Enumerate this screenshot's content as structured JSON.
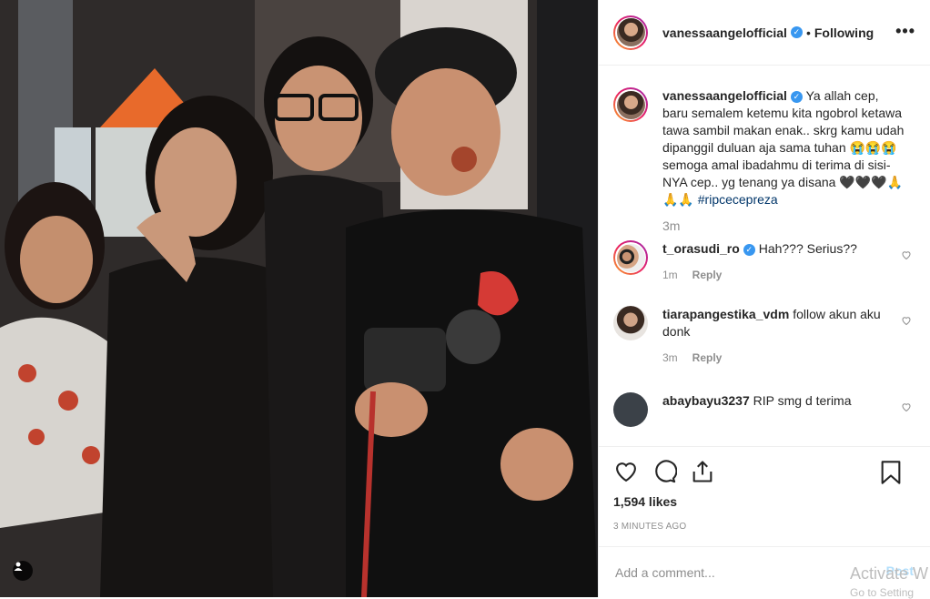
{
  "post": {
    "username": "vanessaangelofficial",
    "dot": "•",
    "follow_status": "Following",
    "more_label": "•••",
    "caption": "Ya allah cep, baru semalem ketemu kita ngobrol ketawa tawa sambil makan enak.. skrg kamu udah dipanggil duluan aja sama tuhan 😭😭😭 semoga amal ibadahmu di terima di sisi-NYA cep.. yg tenang ya disana 🖤🖤🖤🙏🙏🙏",
    "hashtag": "#ripcecepreza",
    "caption_time": "3m",
    "likes": "1,594 likes",
    "posted_ago": "3 MINUTES AGO",
    "add_comment_placeholder": "Add a comment...",
    "post_label": "Post"
  },
  "comments": [
    {
      "username": "t_orasudi_ro",
      "verified": true,
      "text": "Hah??? Serius??",
      "time": "1m",
      "reply": "Reply"
    },
    {
      "username": "tiarapangestika_vdm",
      "verified": false,
      "text": "follow akun aku donk",
      "time": "3m",
      "reply": "Reply"
    },
    {
      "username": "abaybayu3237",
      "verified": false,
      "text": "RIP smg d terima",
      "time": "",
      "reply": ""
    }
  ],
  "watermark": {
    "line1": "Activate W",
    "line2": "Go to Setting"
  },
  "colors": {
    "link": "#003569",
    "verified": "#3897f0",
    "muted": "#8e8e8e"
  }
}
